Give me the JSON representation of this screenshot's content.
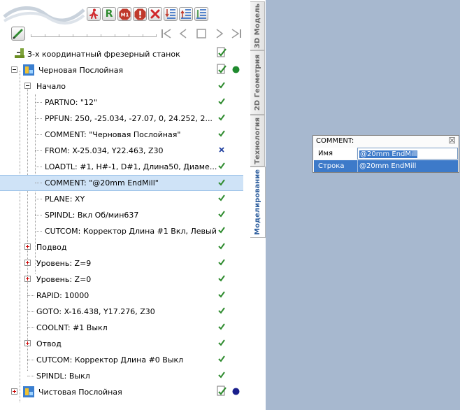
{
  "toolbar": {
    "r_label": "R",
    "m1_label": "M1",
    "colors": {
      "red": "#c0392b",
      "green": "#2e8b2e",
      "blue": "#1f5fbf"
    }
  },
  "tabs": [
    {
      "label": "3D Модель"
    },
    {
      "label": "2D Геометрия"
    },
    {
      "label": "Технология"
    },
    {
      "label": "Моделирование"
    }
  ],
  "tree": {
    "machine": {
      "label": "3-х координатный фрезерный станок"
    },
    "rough": {
      "label": "Черновая Послойная"
    },
    "start": {
      "label": "Начало"
    },
    "items": [
      {
        "label": "PARTNO: \"12\"",
        "status": "ok"
      },
      {
        "label": "PPFUN: 250, -25.034, -27.07, 0, 24.252, 2...",
        "status": "ok"
      },
      {
        "label": "COMMENT: \"Черновая Послойная\"",
        "status": "ok"
      },
      {
        "label": "FROM: X-25.034, Y22.463, Z30",
        "status": "off"
      },
      {
        "label": "LOADTL: #1, H#-1, D#1, Длина50, Диаме...",
        "status": "ok"
      },
      {
        "label": "COMMENT: \"@20mm EndMill\"",
        "status": "ok"
      },
      {
        "label": "PLANE: XY",
        "status": "ok"
      },
      {
        "label": "SPINDL: Вкл Об/мин637",
        "status": "ok"
      },
      {
        "label": "CUTCOM: Корректор Длина #1 Вкл, Левый",
        "status": "ok"
      }
    ],
    "approach": {
      "label": "Подвод"
    },
    "level9": {
      "label": "Уровень: Z=9"
    },
    "level0": {
      "label": "Уровень: Z=0"
    },
    "rapid": {
      "label": "RAPID: 10000"
    },
    "goto": {
      "label": "GOTO: X-16.438, Y17.276, Z30"
    },
    "coolnt": {
      "label": "COOLNT: #1 Выкл"
    },
    "retract": {
      "label": "Отвод"
    },
    "cutcom0": {
      "label": "CUTCOM: Корректор Длина #0 Выкл"
    },
    "spindl_off": {
      "label": "SPINDL: Выкл"
    },
    "finish": {
      "label": "Чистовая Послойная"
    }
  },
  "popup": {
    "title": "COMMENT:",
    "close": "☒",
    "rows": [
      {
        "key": "Имя",
        "value": "@20mm EndMill"
      },
      {
        "key": "Строка",
        "value": "@20mm EndMill"
      }
    ]
  },
  "theme": {
    "viewport_bg": "#a7b8cf",
    "selection_bg": "#cfe3f7",
    "popup_highlight": "#3d7ac9"
  }
}
